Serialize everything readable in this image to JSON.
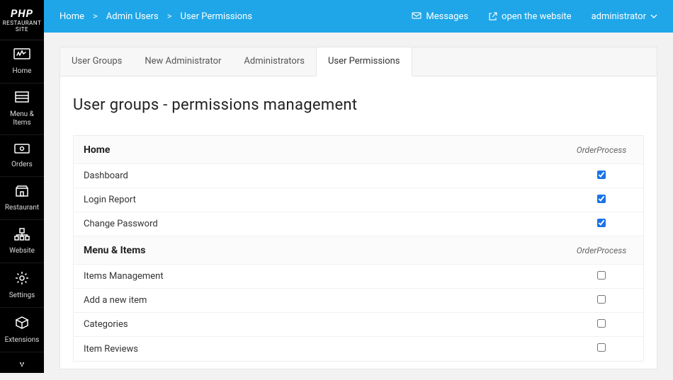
{
  "brand": {
    "line1": "PHP",
    "line2": "RESTAURANT SITE"
  },
  "sidebar": {
    "items": [
      {
        "label": "Home"
      },
      {
        "label": "Menu & Items"
      },
      {
        "label": "Orders"
      },
      {
        "label": "Restaurant"
      },
      {
        "label": "Website"
      },
      {
        "label": "Settings"
      },
      {
        "label": "Extensions"
      }
    ]
  },
  "breadcrumbs": [
    "Home",
    "Admin Users",
    "User Permissions"
  ],
  "topbar": {
    "messages": "Messages",
    "open_site": "open the website",
    "user": "administrator"
  },
  "tabs": [
    {
      "label": "User Groups",
      "active": false
    },
    {
      "label": "New Administrator",
      "active": false
    },
    {
      "label": "Administrators",
      "active": false
    },
    {
      "label": "User Permissions",
      "active": true
    }
  ],
  "page_title": "User groups - permissions management",
  "group_label": "OrderProcess",
  "sections": [
    {
      "title": "Home",
      "rows": [
        {
          "label": "Dashboard",
          "checked": true
        },
        {
          "label": "Login Report",
          "checked": true
        },
        {
          "label": "Change Password",
          "checked": true
        }
      ]
    },
    {
      "title": "Menu & Items",
      "rows": [
        {
          "label": "Items Management",
          "checked": false
        },
        {
          "label": "Add a new item",
          "checked": false
        },
        {
          "label": "Categories",
          "checked": false
        },
        {
          "label": "Item Reviews",
          "checked": false
        }
      ]
    }
  ]
}
